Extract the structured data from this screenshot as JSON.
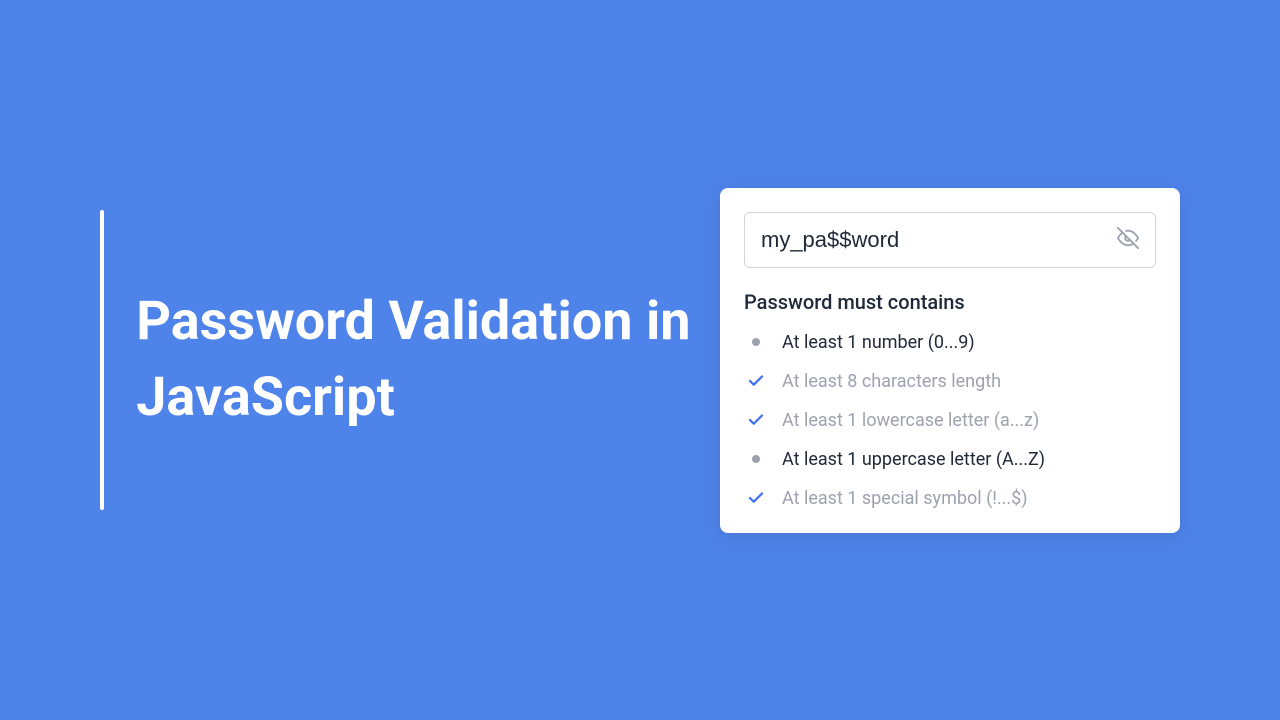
{
  "title": "Password Validation in JavaScript",
  "card": {
    "password_value": "my_pa$$word",
    "requirements_header": "Password must contains",
    "requirements": [
      {
        "label": "At least 1 number (0...9)",
        "met": false
      },
      {
        "label": "At least 8 characters length",
        "met": true
      },
      {
        "label": "At least 1 lowercase letter (a...z)",
        "met": true
      },
      {
        "label": "At least 1 uppercase letter (A...Z)",
        "met": false
      },
      {
        "label": "At least 1 special symbol (!...$)",
        "met": true
      }
    ]
  },
  "colors": {
    "background": "#4e83ea",
    "accent": "#4070f4",
    "text_dark": "#1f2937",
    "text_muted": "#9ca3af"
  }
}
